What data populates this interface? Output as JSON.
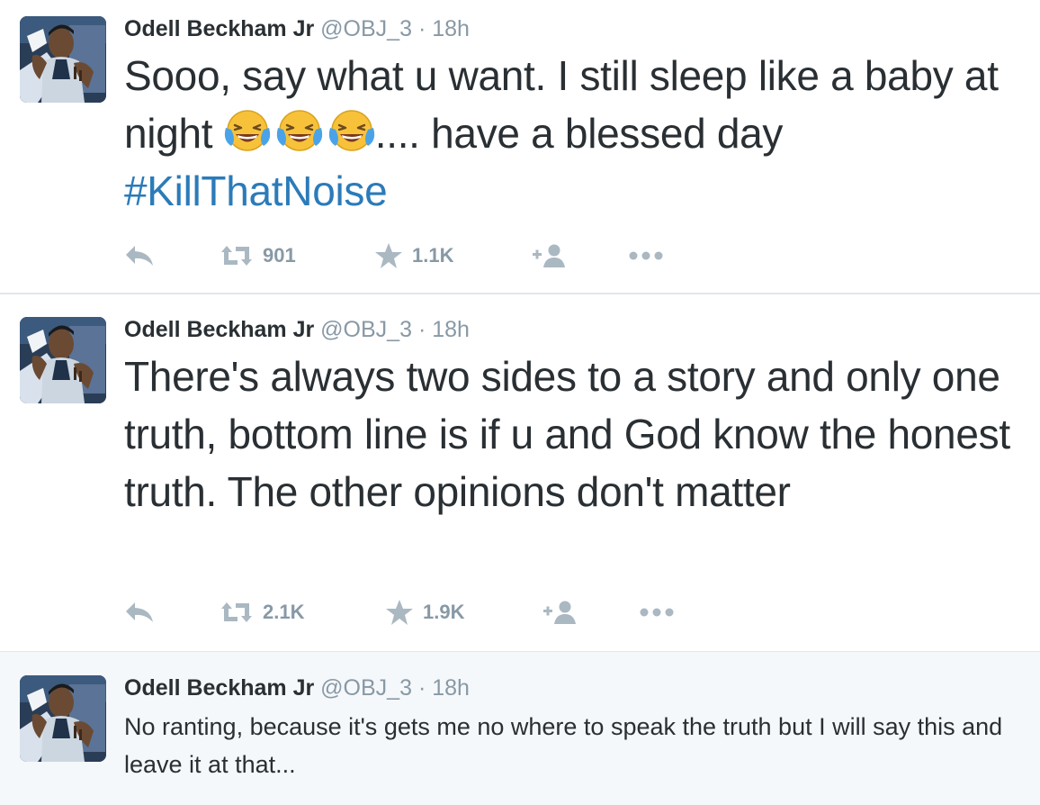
{
  "colors": {
    "text": "#292f33",
    "muted": "#8899a6",
    "icon": "#aab8c2",
    "link": "#2b7bb9",
    "divider": "#e1e8ed",
    "highlight_bg": "#f5f8fa"
  },
  "tweets": [
    {
      "author": {
        "name": "Odell Beckham Jr",
        "handle": "@OBJ_3",
        "separator": "·",
        "time": "18h"
      },
      "text_part1": "Sooo, say what u want. I still sleep like a baby at night ",
      "emoji_name": "face-with-tears-of-joy",
      "text_part2": ".... have a blessed day",
      "hashtag": "#KillThatNoise",
      "stats": {
        "retweets": "901",
        "favorites": "1.1K"
      }
    },
    {
      "author": {
        "name": "Odell Beckham Jr",
        "handle": "@OBJ_3",
        "separator": "·",
        "time": "18h"
      },
      "text": "There's always two sides to a story and only one truth, bottom line is if u and God know the honest truth. The other opinions don't matter",
      "stats": {
        "retweets": "2.1K",
        "favorites": "1.9K"
      }
    },
    {
      "author": {
        "name": "Odell Beckham Jr",
        "handle": "@OBJ_3",
        "separator": "·",
        "time": "18h"
      },
      "text": "No ranting, because it's gets me no where to speak the truth but I will say this and leave it at that..."
    }
  ],
  "icons": {
    "reply": "reply-icon",
    "retweet": "retweet-icon",
    "favorite": "star-icon",
    "follow": "follow-icon",
    "more": "more-icon"
  }
}
